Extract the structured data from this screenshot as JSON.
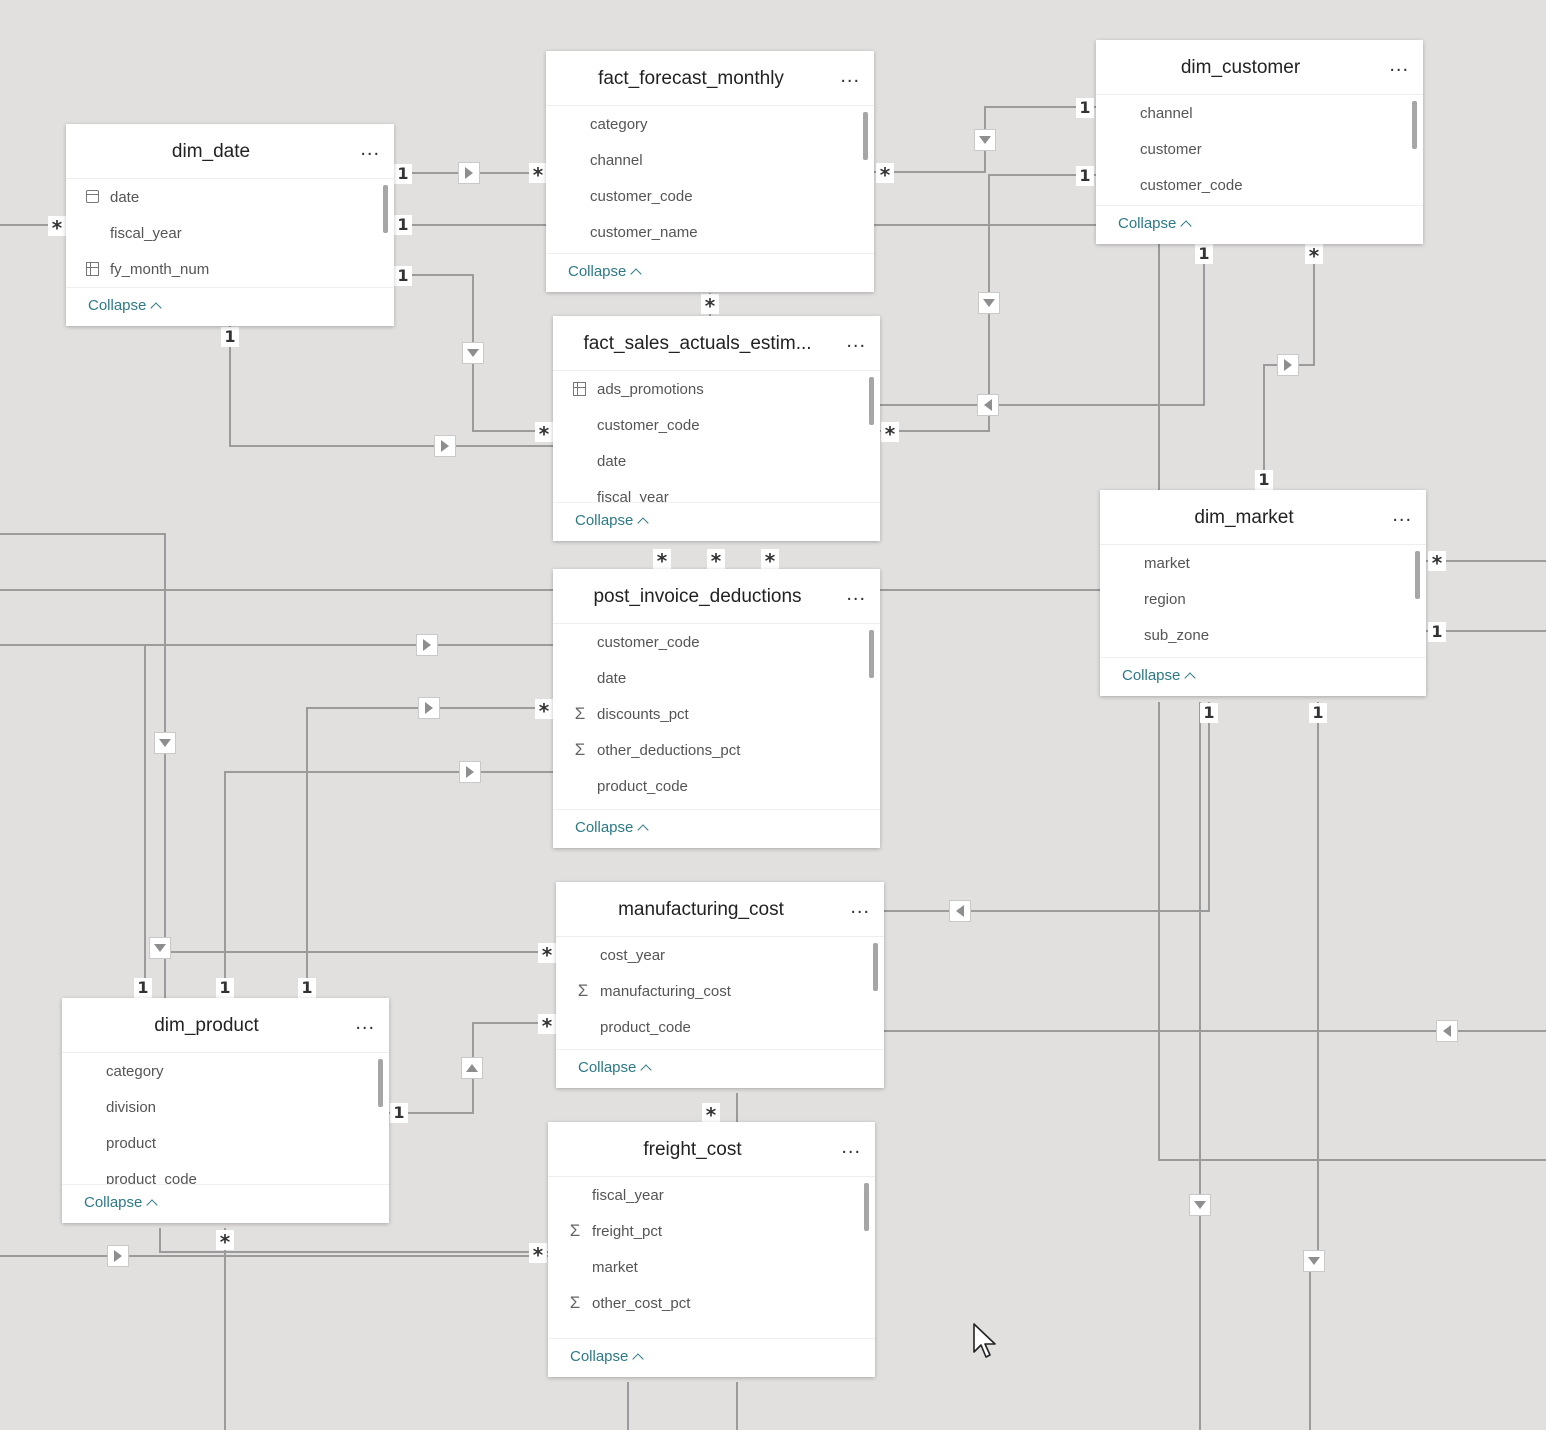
{
  "tables": [
    {
      "id": "dim_date",
      "name": "dim_date",
      "fields": [
        {
          "name": "date",
          "icon": "calendar-icon"
        },
        {
          "name": "fiscal_year",
          "icon": ""
        },
        {
          "name": "fy_month_num",
          "icon": "table-icon"
        }
      ],
      "collapse_label": "Collapse",
      "more_label": "..."
    },
    {
      "id": "fact_forecast_monthly",
      "name": "fact_forecast_monthly",
      "fields": [
        {
          "name": "category",
          "icon": ""
        },
        {
          "name": "channel",
          "icon": ""
        },
        {
          "name": "customer_code",
          "icon": ""
        },
        {
          "name": "customer_name",
          "icon": ""
        }
      ],
      "collapse_label": "Collapse",
      "more_label": "..."
    },
    {
      "id": "dim_customer",
      "name": "dim_customer",
      "fields": [
        {
          "name": "channel",
          "icon": ""
        },
        {
          "name": "customer",
          "icon": ""
        },
        {
          "name": "customer_code",
          "icon": ""
        }
      ],
      "collapse_label": "Collapse",
      "more_label": "..."
    },
    {
      "id": "fact_sales_actuals_estim",
      "name": "fact_sales_actuals_estim...",
      "fields": [
        {
          "name": "ads_promotions",
          "icon": "table-icon"
        },
        {
          "name": "customer_code",
          "icon": ""
        },
        {
          "name": "date",
          "icon": ""
        },
        {
          "name": "fiscal_year",
          "icon": ""
        }
      ],
      "collapse_label": "Collapse",
      "more_label": "..."
    },
    {
      "id": "dim_market",
      "name": "dim_market",
      "fields": [
        {
          "name": "market",
          "icon": ""
        },
        {
          "name": "region",
          "icon": ""
        },
        {
          "name": "sub_zone",
          "icon": ""
        }
      ],
      "collapse_label": "Collapse",
      "more_label": "..."
    },
    {
      "id": "post_invoice_deductions",
      "name": "post_invoice_deductions",
      "fields": [
        {
          "name": "customer_code",
          "icon": ""
        },
        {
          "name": "date",
          "icon": ""
        },
        {
          "name": "discounts_pct",
          "icon": "sigma-icon"
        },
        {
          "name": "other_deductions_pct",
          "icon": "sigma-icon"
        },
        {
          "name": "product_code",
          "icon": ""
        }
      ],
      "collapse_label": "Collapse",
      "more_label": "..."
    },
    {
      "id": "manufacturing_cost",
      "name": "manufacturing_cost",
      "fields": [
        {
          "name": "cost_year",
          "icon": ""
        },
        {
          "name": "manufacturing_cost",
          "icon": "sigma-icon"
        },
        {
          "name": "product_code",
          "icon": ""
        }
      ],
      "collapse_label": "Collapse",
      "more_label": "..."
    },
    {
      "id": "dim_product",
      "name": "dim_product",
      "fields": [
        {
          "name": "category",
          "icon": ""
        },
        {
          "name": "division",
          "icon": ""
        },
        {
          "name": "product",
          "icon": ""
        },
        {
          "name": "product_code",
          "icon": ""
        }
      ],
      "collapse_label": "Collapse",
      "more_label": "..."
    },
    {
      "id": "freight_cost",
      "name": "freight_cost",
      "fields": [
        {
          "name": "fiscal_year",
          "icon": ""
        },
        {
          "name": "freight_pct",
          "icon": "sigma-icon"
        },
        {
          "name": "market",
          "icon": ""
        },
        {
          "name": "other_cost_pct",
          "icon": "sigma-icon"
        }
      ],
      "collapse_label": "Collapse",
      "more_label": "..."
    }
  ],
  "cardinality": {
    "one": "1",
    "many": "*"
  },
  "colors": {
    "canvas": "#e1e0df",
    "line": "#9a9a9a",
    "link": "#2d7a86"
  }
}
